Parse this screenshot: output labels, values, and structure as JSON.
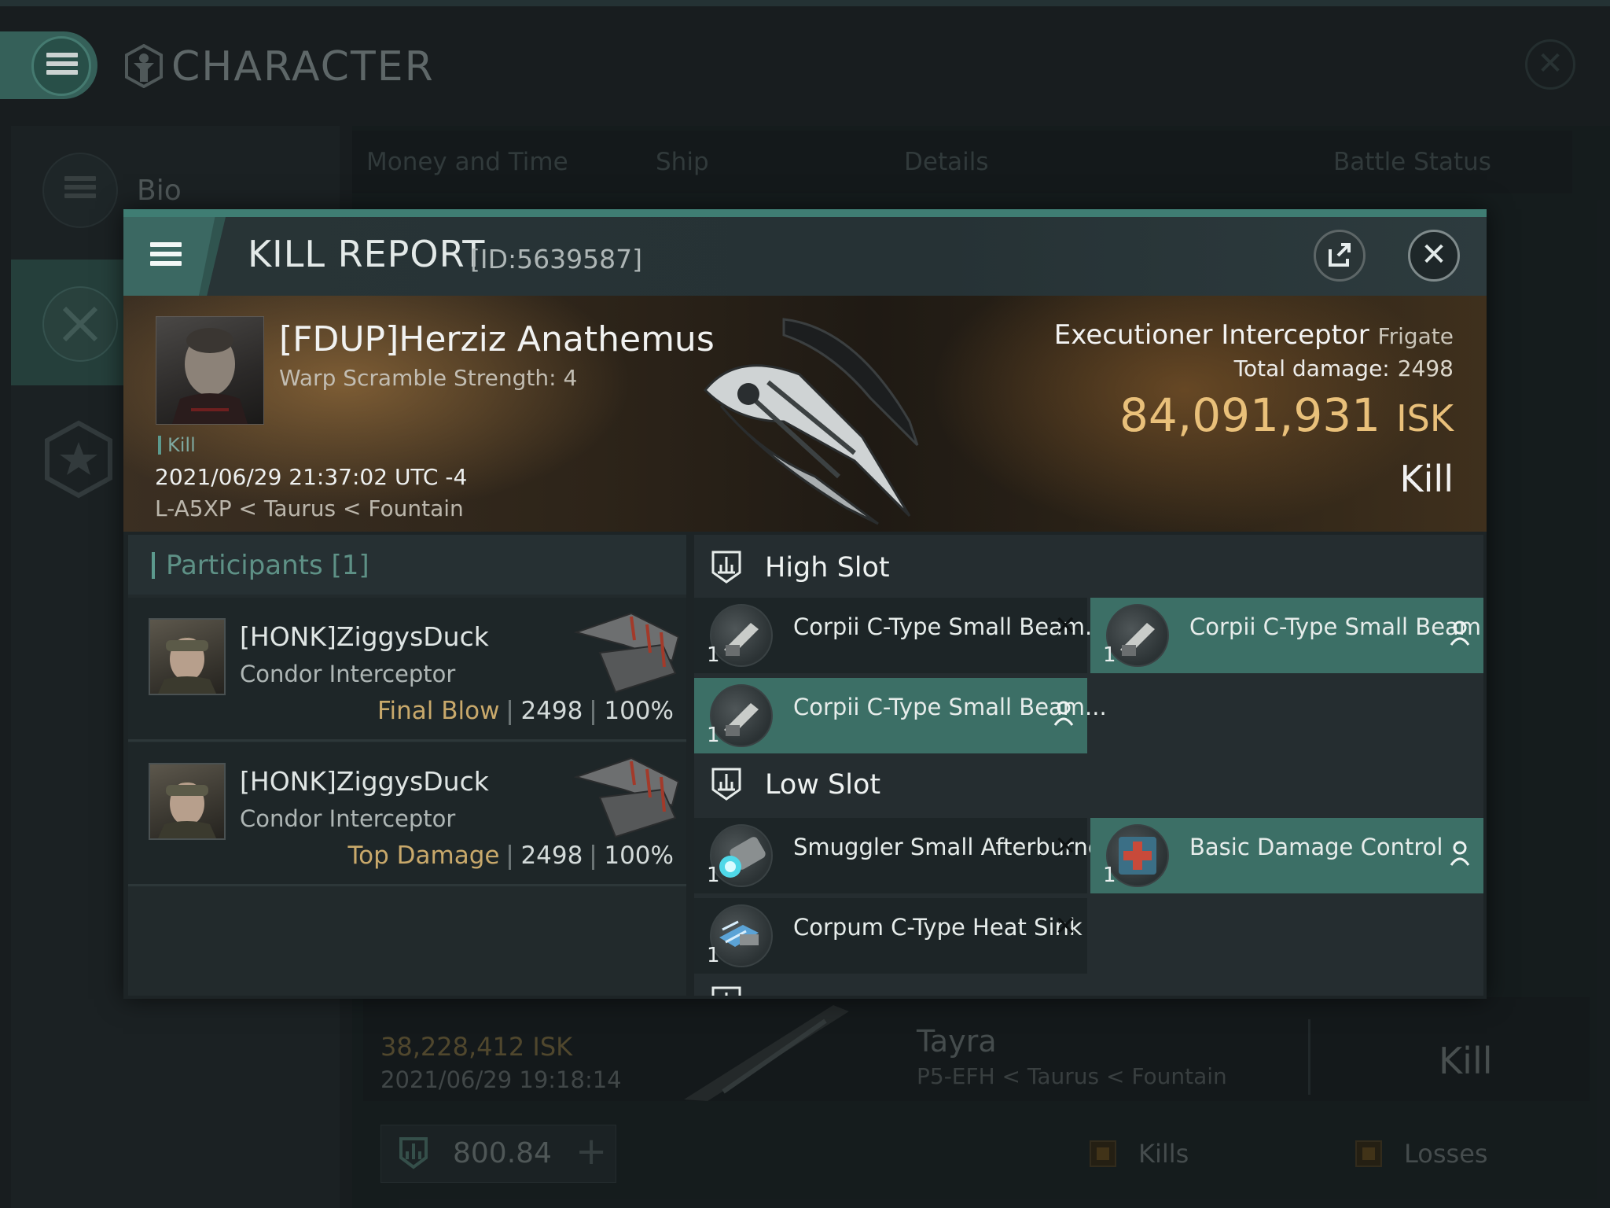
{
  "app": {
    "title": "CHARACTER",
    "sidebar": [
      {
        "label": "Bio",
        "icon": "list-icon"
      },
      {
        "label": "",
        "icon": "crossed-swords-icon"
      },
      {
        "label": "",
        "icon": "star-icon"
      }
    ],
    "tabs": [
      "Money and Time",
      "Ship",
      "Details",
      "Battle Status"
    ],
    "background_row": {
      "isk": "38,228,412  ISK",
      "date": "2021/06/29  19:18:14",
      "ship": "Tayra",
      "location": "P5-EFH < Taurus < Fountain",
      "result": "Kill"
    },
    "footer": {
      "credits": "800.84",
      "kills_label": "Kills",
      "losses_label": "Losses"
    }
  },
  "kill_report": {
    "title": "KILL REPORT",
    "id": "[ID:5639587]",
    "victim": {
      "name": "[FDUP]Herziz Anathemus",
      "warp": "Warp Scramble Strength: 4",
      "tag": "Kill",
      "datetime": "2021/06/29 21:37:02 UTC -4",
      "location": "L-A5XP < Taurus < Fountain"
    },
    "ship": {
      "name": "Executioner Interceptor",
      "class": "Frigate",
      "total_damage_label": "Total damage:",
      "total_damage": "2498",
      "isk_value": "84,091,931",
      "isk_unit": "ISK",
      "result": "Kill"
    },
    "participants": {
      "title": "Participants [1]",
      "rows": [
        {
          "name": "[HONK]ZiggysDuck",
          "ship": "Condor Interceptor",
          "role": "Final Blow",
          "damage": "2498",
          "percent": "100%"
        },
        {
          "name": "[HONK]ZiggysDuck",
          "ship": "Condor Interceptor",
          "role": "Top Damage",
          "damage": "2498",
          "percent": "100%"
        }
      ]
    },
    "slots": {
      "high": {
        "title": "High Slot",
        "items": [
          {
            "name": "Corpii C-Type Small Beam...",
            "qty": "1",
            "state": "destroyed"
          },
          {
            "name": "Corpii C-Type Small Beam...",
            "qty": "1",
            "state": "dropped"
          },
          {
            "name": "Corpii C-Type Small Beam...",
            "qty": "1",
            "state": "dropped"
          }
        ]
      },
      "low": {
        "title": "Low Slot",
        "items": [
          {
            "name": "Smuggler Small Afterburner",
            "qty": "1",
            "state": "destroyed"
          },
          {
            "name": "Basic Damage Control",
            "qty": "1",
            "state": "dropped"
          },
          {
            "name": "Corpum C-Type Heat Sink",
            "qty": "1",
            "state": "destroyed"
          }
        ]
      }
    }
  },
  "colors": {
    "accent": "#3c6f66",
    "isk": "#e9c07a",
    "role": "#c9a96b"
  }
}
